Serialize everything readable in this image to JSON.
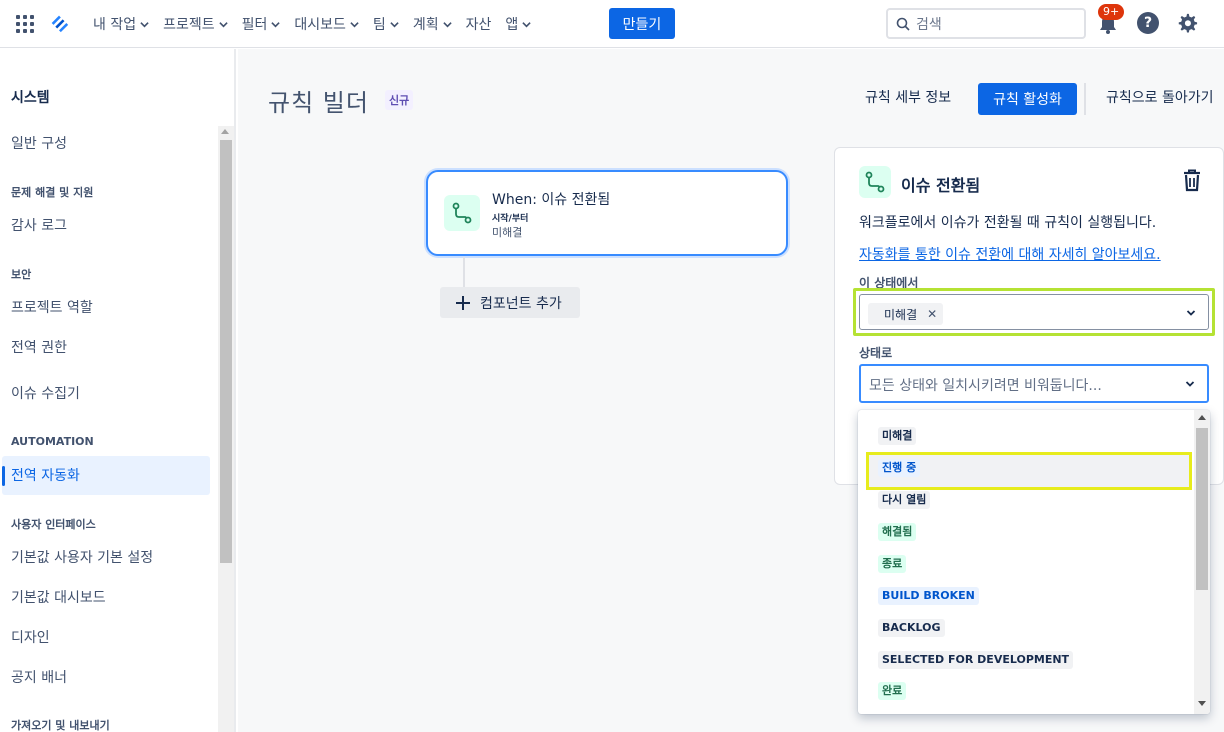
{
  "topnav": {
    "items": [
      "내 작업",
      "프로젝트",
      "필터",
      "대시보드",
      "팀",
      "계획",
      "자산",
      "앱"
    ],
    "create_label": "만들기",
    "search_placeholder": "검색",
    "notification_badge": "9+"
  },
  "sidebar": {
    "title": "시스템",
    "general": "일반 구성",
    "section_troubleshooting": "문제 해결 및 지원",
    "audit_log": "감사 로그",
    "section_security": "보안",
    "project_roles": "프로젝트 역할",
    "global_permissions": "전역 권한",
    "issue_collectors": "이슈 수집기",
    "section_automation": "AUTOMATION",
    "global_automation": "전역 자동화",
    "section_ui": "사용자 인터페이스",
    "default_user_prefs": "기본값 사용자 기본 설정",
    "default_dashboard": "기본값 대시보드",
    "design": "디자인",
    "announcement_banner": "공지 배너",
    "section_import_export": "가져오기 및 내보내기"
  },
  "main": {
    "page_title": "규칙 빌더",
    "new_label": "신규",
    "rule_details": "규칙 세부 정보",
    "enable_rule": "규칙 활성화",
    "back_to_rules": "규칙으로 돌아가기",
    "trigger": {
      "title": "When: 이슈 전환됨",
      "label": "시작/부터",
      "status": "미해결"
    },
    "add_component": "컴포넌트 추가"
  },
  "panel": {
    "title": "이슈 전환됨",
    "description": "워크플로에서 이슈가 전환될 때 규칙이 실행됩니다.",
    "learn_more": "자동화를 통한 이슈 전환에 대해 자세히 알아보세요.",
    "from_label": "이 상태에서",
    "from_chip": "미해결",
    "to_label": "상태로",
    "to_placeholder": "모든 상태와 일치시키려면 비워둡니다..."
  },
  "dropdown": {
    "options": [
      {
        "label": "미해결",
        "color": "grey"
      },
      {
        "label": "진행 중",
        "color": "blue"
      },
      {
        "label": "다시 열림",
        "color": "grey"
      },
      {
        "label": "해결됨",
        "color": "green"
      },
      {
        "label": "종료",
        "color": "green"
      },
      {
        "label": "BUILD BROKEN",
        "color": "blue"
      },
      {
        "label": "BACKLOG",
        "color": "grey"
      },
      {
        "label": "SELECTED FOR DEVELOPMENT",
        "color": "grey"
      },
      {
        "label": "완료",
        "color": "green"
      }
    ]
  }
}
